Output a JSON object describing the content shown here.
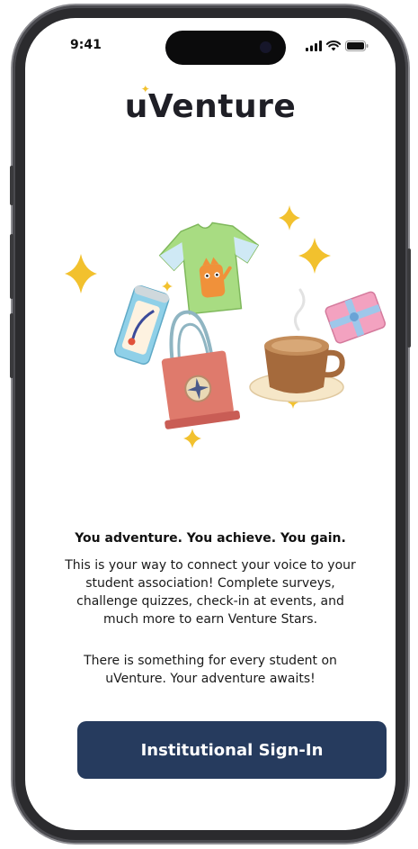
{
  "status_bar": {
    "time": "9:41",
    "icons": [
      "signal-icon",
      "wifi-icon",
      "battery-icon"
    ]
  },
  "app": {
    "logo": "uVenture"
  },
  "onboarding": {
    "tagline": "You adventure. You achieve. You gain.",
    "paragraph1": "This is your way to connect your voice to your student association! Complete surveys, challenge quizzes, check-in at events, and much more to earn Venture Stars.",
    "paragraph2": "There is something for every student on uVenture. Your adventure awaits!",
    "illustration_items": [
      "t-shirt",
      "drink-can",
      "tote-bag",
      "coffee-cup",
      "gift-card",
      "stars"
    ]
  },
  "actions": {
    "signin_label": "Institutional Sign-In"
  },
  "colors": {
    "primary_button": "#263b5e",
    "star": "#f2c12e",
    "text": "#1a1a1a"
  }
}
